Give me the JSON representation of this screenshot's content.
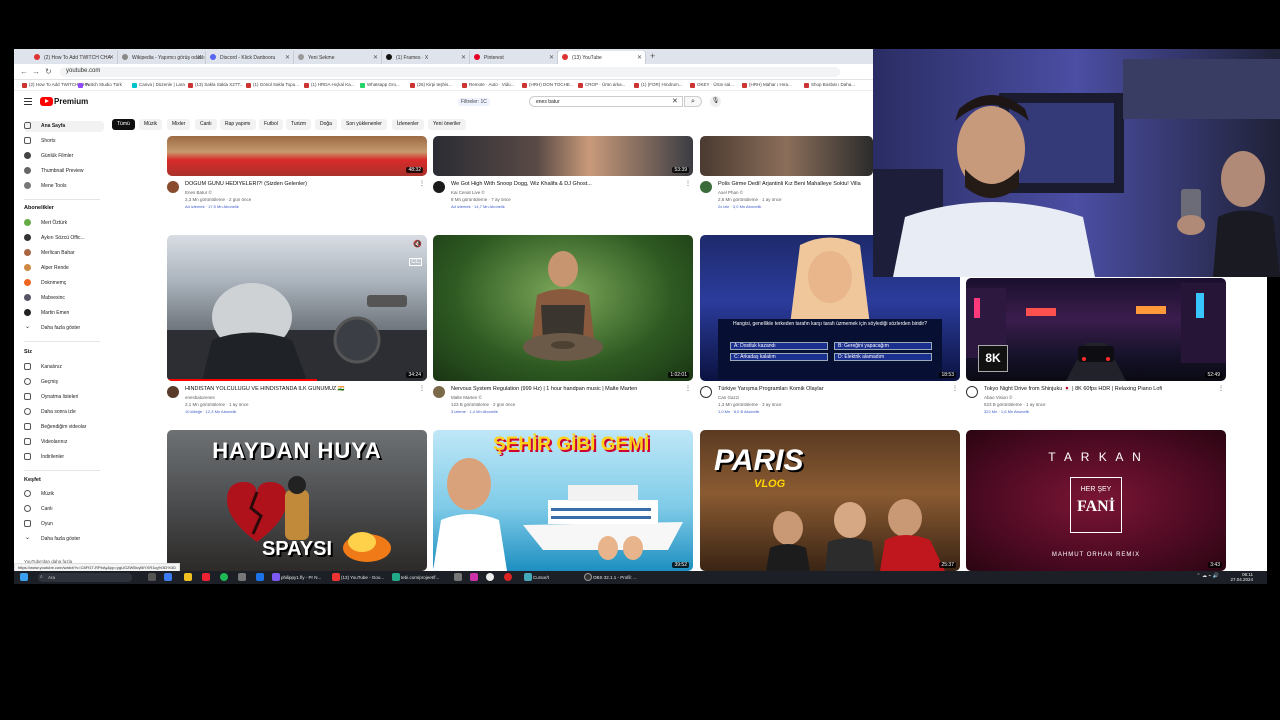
{
  "browser": {
    "tabs": [
      {
        "label": "(2) How To Add TWITCH CHA"
      },
      {
        "label": "Wikipedia - Yapımcı görüş odaklı"
      },
      {
        "label": "Discord - Klick Danbooru"
      },
      {
        "label": "Yeni Sekme"
      },
      {
        "label": "(1) Frames · X"
      },
      {
        "label": "Pinterest"
      },
      {
        "label": "(13) YouTube"
      }
    ],
    "url": "youtube.com",
    "bookmarks": [
      "(2) How To Add TWITCH CHA",
      "Twitch Studio Türk",
      "Canva | Düzenle | Lara",
      "(13) Sakla Sakla X2TT...",
      "(1) Gönül Sakla Topu...",
      "(1) HRDA Hıçkal Ka...",
      "Whatsapp Gro...",
      "(25) Kirpi teşhis...",
      "Remote · Auto · Vidu...",
      "(HRH) DON TOCHE...",
      "CROP · Ürün arka...",
      "(1) (FOR) Hındrum...",
      "OKEY · Ürün sal...",
      "(HRH) Mahar ı Hıra...",
      "Shop Bosbat ı Daha..."
    ]
  },
  "youtube": {
    "brand": "Premium",
    "filter_chip": "Filtreler: 1C",
    "search_value": "enes batur",
    "chips": [
      "Tümü",
      "Müzik",
      "Mixler",
      "Canlı",
      "Rap yapımı",
      "Futbol",
      "Turizm",
      "Doğa",
      "Son yüklenenler",
      "İzlenenler",
      "Yeni öneriler"
    ],
    "sidebar": {
      "main": [
        "Ana Sayfa",
        "Shorts",
        "Günlük Filmler",
        "Thumbnail Preview",
        "Mene Tools"
      ],
      "subs_header": "Abonelikler",
      "subs": [
        "Mert Öztürk",
        "Aykırı Sözcü Offic...",
        "Merlican Bahar",
        "Alper Rende",
        "Doknmemç",
        "Mabvesinc",
        "Martin Emen",
        "Daha fazla göster"
      ],
      "you_header": "Siz",
      "you": [
        "Kanalınız",
        "Geçmiş",
        "Oynatma listeleri",
        "Daha sonra izle",
        "Beğendiğim videolar",
        "Videolarınız",
        "İndirilenler"
      ],
      "explore_header": "Keşfet",
      "explore": [
        "Müzik",
        "Canlı",
        "Oyun",
        "Daha fazla göster"
      ],
      "footer": "YouTube'dan daha fazla"
    },
    "videos_row0": [
      {
        "title": "DOĞUM GÜNÜ HEDİYELERİ?! (Sizden Gelenler)",
        "channel": "Enes Batur ©",
        "meta": "2,3 Mn görüntüleme · 2 gün önce",
        "badges": "Ad izlemek · 17,5 Mn Abonelik",
        "duration": "48:32"
      },
      {
        "title": "We Got High With Snoop Dogg, Wiz Khalifa & DJ Ghost...",
        "channel": "Kai Cenat Live ©",
        "meta": "8 Mn görüntüleme · 7 ay önce",
        "badges": "Ad izlemek · 14,7 Mn Abonelik",
        "duration": "53:39"
      },
      {
        "title": "Polis Girme Dedi! Arjantinli Kız Beni Mahalleye Soktu! Villa",
        "channel": "Axel Phan ©",
        "meta": "2,6 Mn görüntüleme · 1 ay önce",
        "badges": "2x izle · 3,0 Mn Abonelik",
        "duration": ""
      }
    ],
    "videos_row1": [
      {
        "title": "HİNDİSTAN YOLCULUĞU VE HİNDİSTANDA İLK GÜNÜMÜZ 🇮🇳",
        "channel": "enesbaturenes",
        "meta": "2,1 Mn görüntüleme · 1 ay önce",
        "badges": "10 kitleğe · 12,3 Mn Abonelik",
        "duration": "34:24"
      },
      {
        "title": "Nervous System Regulation (999 Hz) | 1 hour handpan music | Malte Marten",
        "channel": "Malte Marten ©",
        "meta": "123 B görüntüleme · 2 gün önce",
        "badges": "3 izleme · 1,4 Mn Abonelik",
        "duration": "1:02:01"
      },
      {
        "title": "Türkiye Yarışma Programları Komik Olaylar",
        "channel": "Can Gazzi",
        "meta": "1,3 Mn görüntüleme · 3 ay önce",
        "badges": "1,0 Mn · 8,0 B Abonelik",
        "duration": "18:53"
      },
      {
        "title": "Tokyo Night Drive from Shinjuku 🇯🇵 | 8K 60fps HDR | Relaxing Piano Lofi",
        "channel": "Abao Vision ©",
        "meta": "523 B görüntüleme · 1 ay önce",
        "badges": "322 Mn · 1,6 Mn Abonelik",
        "duration": "52:49"
      }
    ],
    "videos_row2": [
      {
        "title": "HAYDAN HUYA SPAYSI",
        "duration": ""
      },
      {
        "title": "ŞEHİR GİBİ GEMİ",
        "duration": "39:52"
      },
      {
        "title": "PARIS VLOG",
        "duration": "25:37"
      },
      {
        "title": "TARKAN HER ŞEY FANİ",
        "duration": "3:43"
      }
    ],
    "thumb_texts": {
      "quiz_question": "Hangisi, genellikle terkeden tarafın karşı tarafı üzmemek için söylediği sözlerden biridir?",
      "quiz_a": "A: Dostluk kazandı",
      "quiz_b": "B: Gereğini yapacağım",
      "quiz_c": "C: Arkadaş kalalım",
      "quiz_d": "D: Elektrik alamadım",
      "badge_8k": "8K",
      "haydan": "HAYDAN HUYA",
      "spaysi": "SPAYSI",
      "sehir": "ŞEHİR GİBİ GEMİ",
      "paris": "PARIS",
      "vlog": "VLOG",
      "tarkan": "T A R K A N",
      "hersey": "HER ŞEY",
      "fani": "FANİ",
      "remix": "MAHMUT ORHAN REMIX"
    }
  },
  "statusbar_url": "https://www.youtube.com/watch?v=C8Ff1T-RPbAy&pp=ygUGZW5lcyBiYXR1cg%3D%3D",
  "taskbar": {
    "search": "Ara",
    "apps": [
      "philippy1.fly - Pr N...",
      "(13) YouTube - Goo...",
      "tebi.com/projeet/f...",
      "Cursor/t",
      "OBS 32.1.1 - Profil: ..."
    ],
    "time": "06:11",
    "date": "27.04.2024"
  },
  "colors": {
    "accent": "#ff0000",
    "chip_active": "#0f0f0f",
    "link_badge": "#3a5bc7"
  }
}
